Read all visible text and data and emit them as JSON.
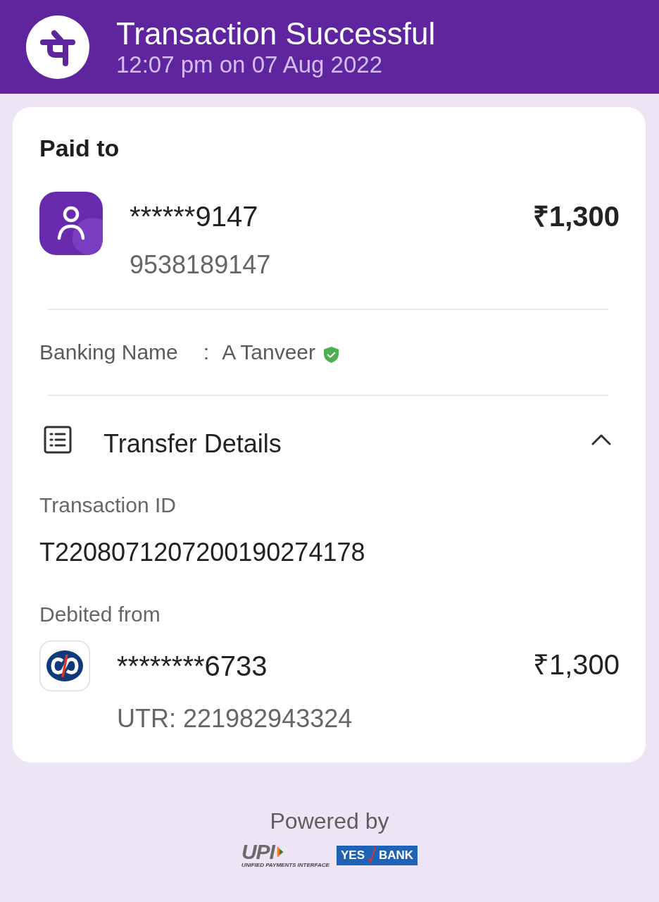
{
  "header": {
    "title": "Transaction Successful",
    "subtitle": "12:07 pm on 07 Aug 2022"
  },
  "paid_to": {
    "heading": "Paid to",
    "name": "******9147",
    "phone": "9538189147",
    "amount": "₹1,300",
    "banking_name_label": "Banking Name",
    "separator": ":",
    "banking_name": "A Tanveer",
    "verified": true
  },
  "transfer_details": {
    "title": "Transfer Details",
    "expanded": true,
    "fields": [
      {
        "label": "Transaction ID",
        "value": "T2208071207200190274178"
      }
    ],
    "debited_from": {
      "label": "Debited from",
      "account": "********6733",
      "amount": "₹1,300",
      "utr": "UTR: 221982943324"
    }
  },
  "footer": {
    "powered_by": "Powered by",
    "upi_logo": {
      "text": "UPI",
      "caption": "UNIFIED PAYMENTS INTERFACE"
    },
    "bank_logo": {
      "left": "YES",
      "right": "BANK"
    }
  }
}
